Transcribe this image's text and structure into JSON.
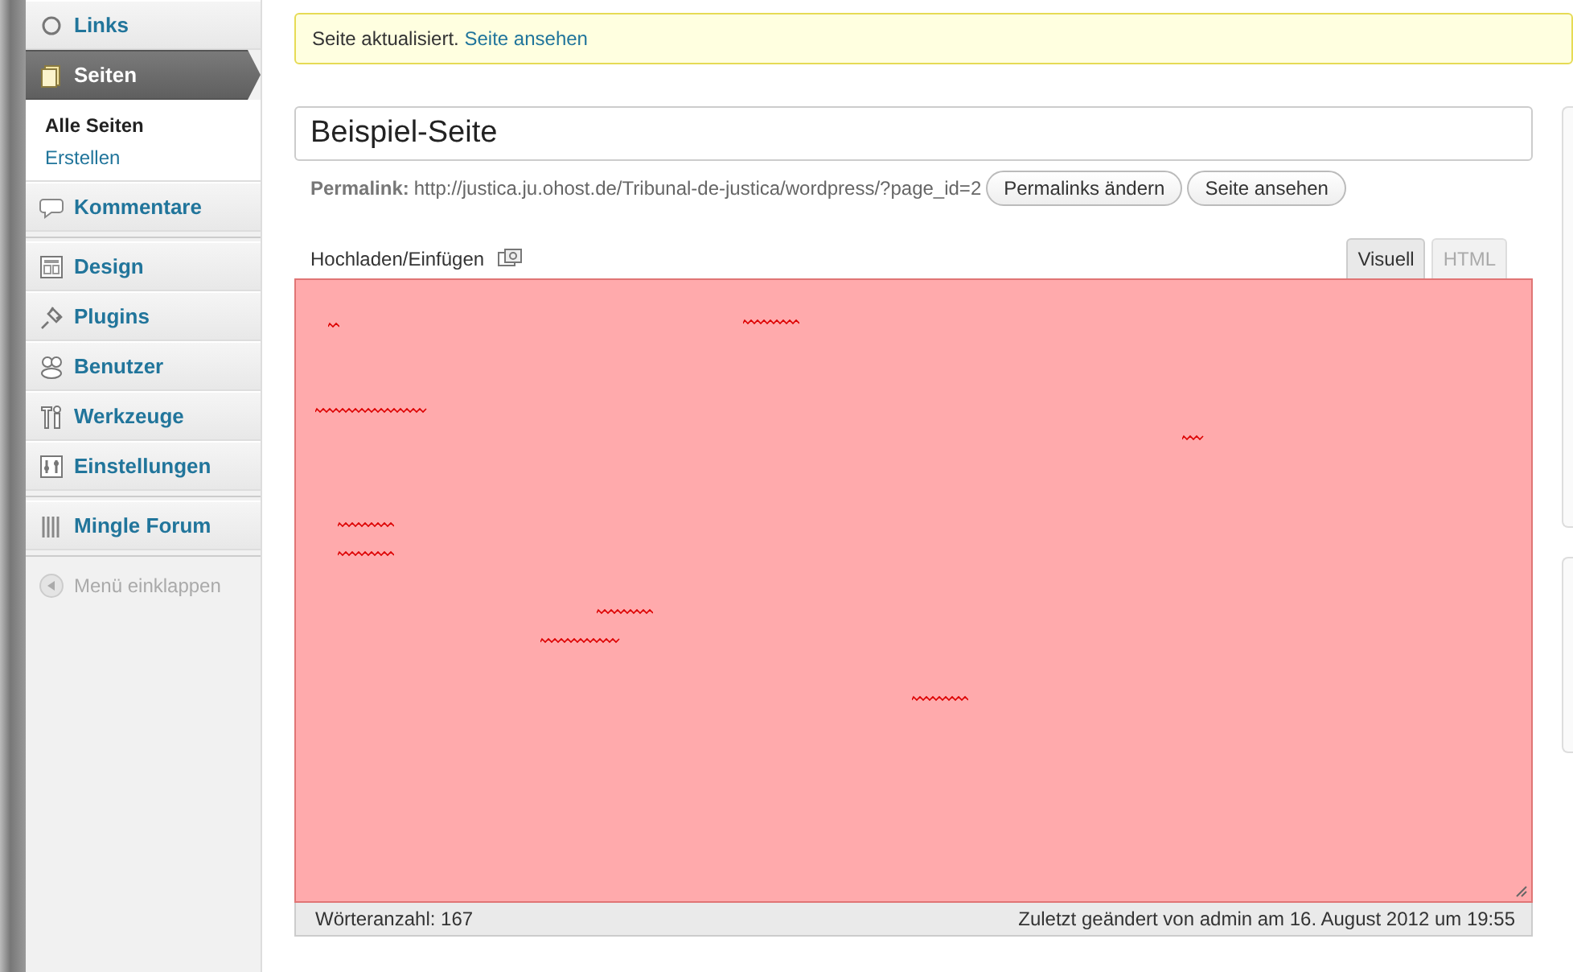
{
  "menu_groups": [
    [
      {
        "label": "Links",
        "selected": false
      },
      {
        "label": "Seiten",
        "selected": true,
        "submenu": [
          {
            "label": "Alle Seiten",
            "selected": true
          },
          {
            "label": "Erstellen",
            "selected": false
          }
        ]
      },
      {
        "label": "Kommentare",
        "selected": false
      }
    ],
    [
      {
        "label": "Design",
        "selected": false
      },
      {
        "label": "Plugins",
        "selected": false
      },
      {
        "label": "Benutzer",
        "selected": false
      },
      {
        "label": "Werkzeuge",
        "selected": false
      },
      {
        "label": "Einstellungen",
        "selected": false
      }
    ],
    [
      {
        "label": "Mingle Forum",
        "selected": false
      }
    ]
  ],
  "collapse": {
    "label": "Menü einklappen"
  },
  "notice": {
    "text": "Seite aktualisiert.",
    "link": "Seite ansehen"
  },
  "title_field": {
    "value": "Beispiel-Seite"
  },
  "permalink": {
    "label": "Permalink:",
    "url": "http://justica.ju.ohost.de/Tribunal-de-justica/wordpress/?page_id=2",
    "buttons": [
      "Permalinks ändern",
      "Seite ansehen"
    ]
  },
  "media": {
    "label": "Hochladen/Einfügen"
  },
  "editor_tabs": [
    {
      "label": "Visuell",
      "selected": true
    },
    {
      "label": "HTML",
      "selected": false
    }
  ],
  "status_bar": {
    "word_count": "Wörteranzahl: 167",
    "last_edited": "Zuletzt geändert von admin am 16. August 2012 um 19:55"
  }
}
